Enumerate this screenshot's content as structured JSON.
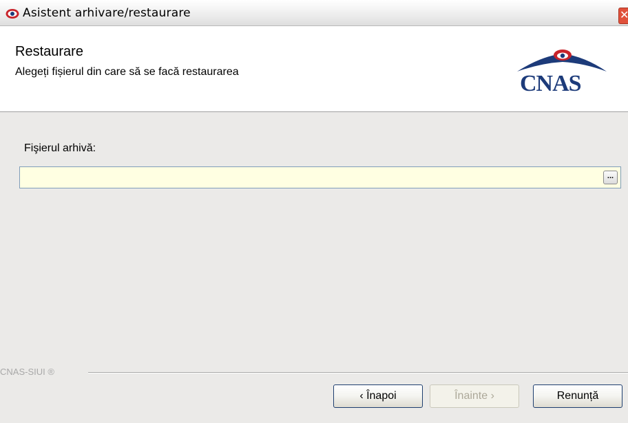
{
  "window": {
    "title": "Asistent arhivare/restaurare",
    "close_glyph": "✕"
  },
  "header": {
    "title": "Restaurare",
    "subtitle": "Alegeți fișierul din care să se facă restaurarea",
    "logo_text": "CNAS"
  },
  "form": {
    "archive_label": "Fişierul arhivă:",
    "archive_value": "",
    "browse_label": "..."
  },
  "footer": {
    "brand": "CNAS-SIUI ®",
    "back_label": "‹ Înapoi",
    "next_label": "Înainte ›",
    "cancel_label": "Renunță"
  },
  "colors": {
    "input_background": "#ffffe2",
    "logo_blue": "#1d3b7a",
    "logo_red": "#c8242b"
  }
}
